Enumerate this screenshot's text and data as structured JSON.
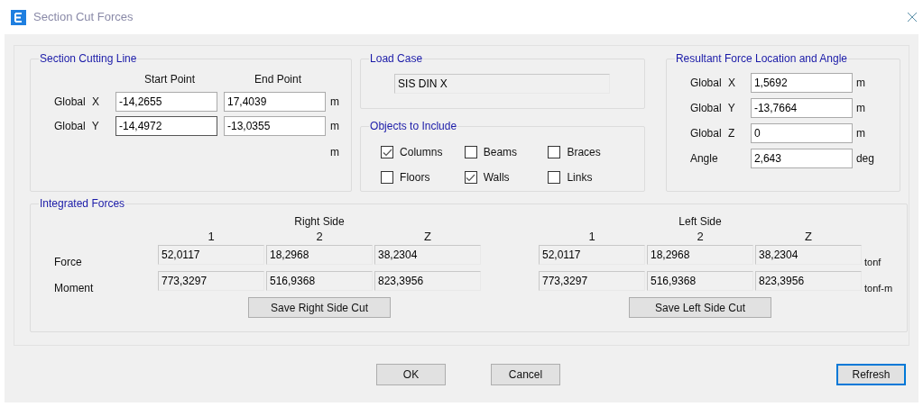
{
  "window": {
    "title": "Section Cut Forces"
  },
  "section_cutting_line": {
    "title": "Section Cutting Line",
    "columns": [
      "Start Point",
      "End Point"
    ],
    "rows": [
      {
        "label": "Global X",
        "start": {
          "value": "-14,2655",
          "focused": false
        },
        "end": {
          "value": "17,4039",
          "focused": false
        },
        "unit": "m"
      },
      {
        "label": "Global Y",
        "start": {
          "value": "-14,4972",
          "focused": true
        },
        "end": {
          "value": "-13,0355",
          "focused": false
        },
        "unit": "m"
      }
    ],
    "extra_unit": "m"
  },
  "load_case": {
    "title": "Load Case",
    "value": "SIS DIN X"
  },
  "objects": {
    "title": "Objects to Include",
    "items": [
      {
        "label": "Columns",
        "checked": true
      },
      {
        "label": "Beams",
        "checked": false
      },
      {
        "label": "Braces",
        "checked": false
      },
      {
        "label": "Floors",
        "checked": false
      },
      {
        "label": "Walls",
        "checked": true
      },
      {
        "label": "Links",
        "checked": false
      }
    ]
  },
  "resultant": {
    "title": "Resultant Force Location and Angle",
    "rows": [
      {
        "label": "Global X",
        "value": "1,5692",
        "unit": "m"
      },
      {
        "label": "Global Y",
        "value": "-13,7664",
        "unit": "m"
      },
      {
        "label": "Global Z",
        "value": "0",
        "unit": "m"
      },
      {
        "label": "Angle",
        "value": "2,643",
        "unit": "deg"
      }
    ]
  },
  "integrated_forces": {
    "title": "Integrated Forces",
    "row_labels": [
      "Force",
      "Moment"
    ],
    "units": [
      "tonf",
      "tonf-m"
    ],
    "sides": [
      {
        "title": "Right Side",
        "columns": [
          "1",
          "2",
          "Z"
        ],
        "rows": [
          [
            "52,0117",
            "18,2968",
            "38,2304"
          ],
          [
            "773,3297",
            "516,9368",
            "823,3956"
          ]
        ],
        "button": "Save Right Side Cut"
      },
      {
        "title": "Left Side",
        "columns": [
          "1",
          "2",
          "Z"
        ],
        "rows": [
          [
            "52,0117",
            "18,2968",
            "38,2304"
          ],
          [
            "773,3297",
            "516,9368",
            "823,3956"
          ]
        ],
        "button": "Save Left Side Cut"
      }
    ]
  },
  "buttons": [
    {
      "label": "OK",
      "default": false
    },
    {
      "label": "Cancel",
      "default": false
    },
    {
      "label": "Refresh",
      "default": true
    }
  ]
}
